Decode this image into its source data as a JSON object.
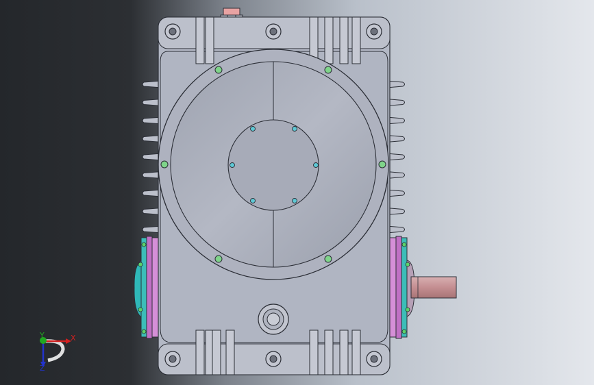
{
  "viewport": {
    "background_dark": "#2a2d31",
    "background_light": "#dfe3ea"
  },
  "colors": {
    "housing": "#b2b7c4",
    "housing_light": "#c9ccd6",
    "housing_dark": "#8f94a2",
    "cover": "#a3a8b5",
    "stroke": "#2b2e36",
    "bolt_green": "#7fd48a",
    "hole_cyan": "#5ec8d4",
    "bearing_magenta": "#c070c4",
    "bearing_teal": "#2fb8b8",
    "shaft": "#c99a9c",
    "vent": "#e8a3a3"
  },
  "triad": {
    "x_label": "X",
    "y_label": "Y",
    "z_label": "Z",
    "x_color": "#d32020",
    "y_color": "#21a821",
    "z_color": "#2233cc"
  }
}
